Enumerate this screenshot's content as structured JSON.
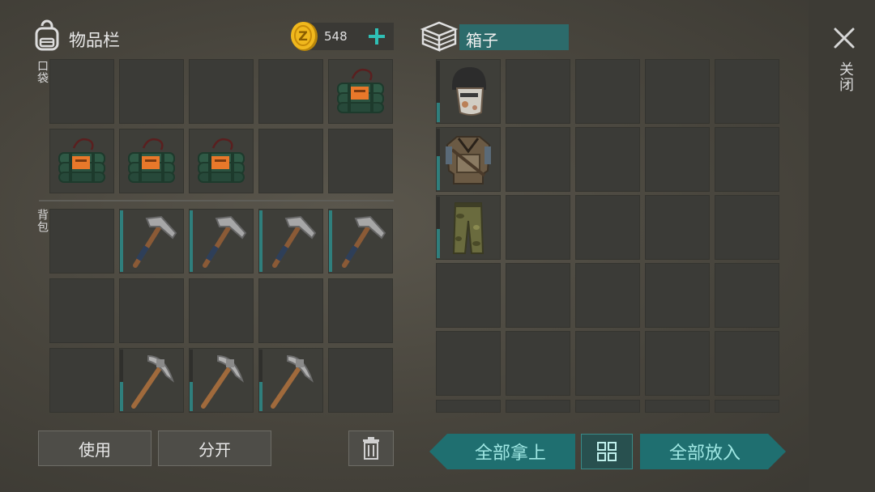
{
  "inventory": {
    "title": "物品栏",
    "coins": "548",
    "add_icon": "plus",
    "pocket_label": "口袋",
    "backpack_label": "背包",
    "pocket_items": [
      "",
      "",
      "",
      "",
      "c4-explosive",
      "c4-explosive",
      "c4-explosive",
      "c4-explosive",
      "",
      ""
    ],
    "backpack_items": [
      "",
      "hammer",
      "hammer",
      "hammer",
      "hammer",
      "",
      "",
      "",
      "",
      "",
      "",
      "pickaxe",
      "pickaxe",
      "pickaxe",
      ""
    ]
  },
  "container": {
    "title": "箱子",
    "items": [
      "helmet",
      "armor-vest",
      "camo-pants"
    ]
  },
  "close": {
    "label": "关闭"
  },
  "buttons": {
    "use": "使用",
    "split": "分开",
    "take_all": "全部拿上",
    "put_all": "全部放入"
  },
  "colors": {
    "accent": "#1f6f70",
    "accent_text": "#9fe7e3",
    "slot": "#3b3b37"
  }
}
